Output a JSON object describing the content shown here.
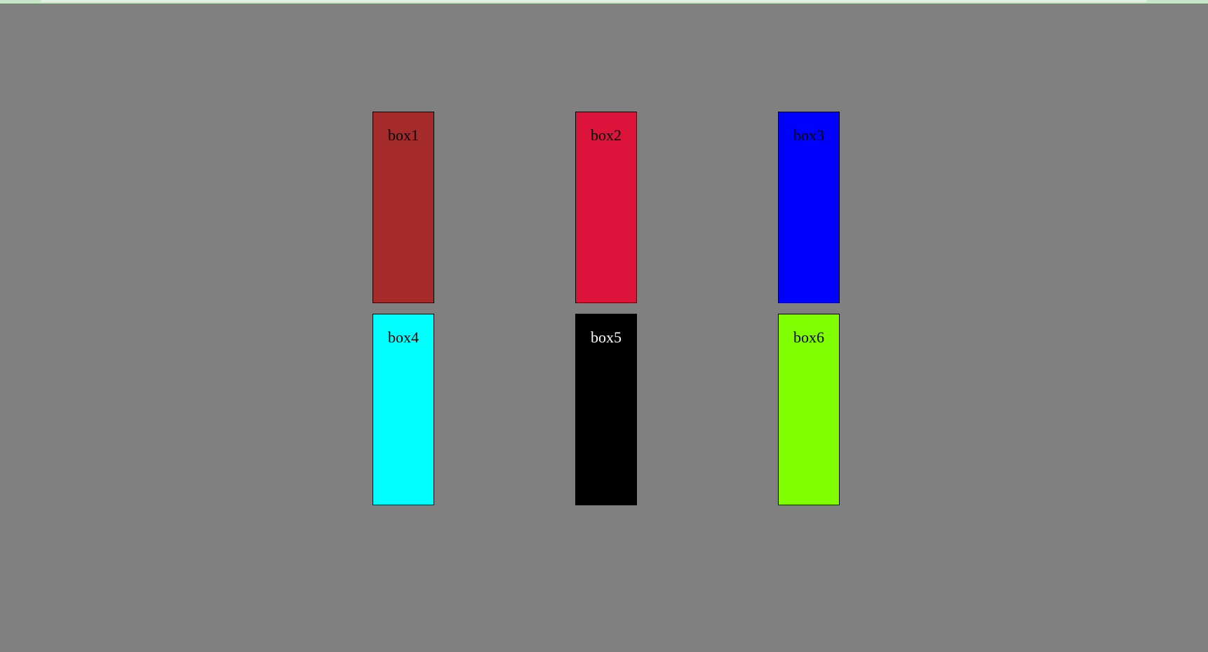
{
  "boxes": [
    {
      "label": "box1",
      "bg": "#a52a2a",
      "text_color": "#000000"
    },
    {
      "label": "box2",
      "bg": "#dc143c",
      "text_color": "#000000"
    },
    {
      "label": "box3",
      "bg": "#0000ff",
      "text_color": "#000000"
    },
    {
      "label": "box4",
      "bg": "#00ffff",
      "text_color": "#000000"
    },
    {
      "label": "box5",
      "bg": "#000000",
      "text_color": "#ffffff"
    },
    {
      "label": "box6",
      "bg": "#7fff00",
      "text_color": "#000000"
    }
  ],
  "colors": {
    "page_background": "#808080",
    "top_strip": "#c8e6c8"
  }
}
